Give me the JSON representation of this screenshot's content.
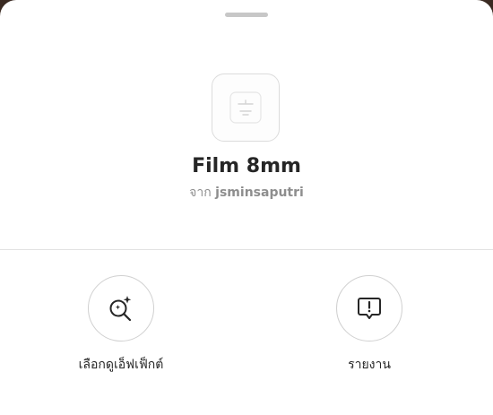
{
  "sheet": {
    "effect": {
      "title": "Film 8mm",
      "author_prefix": "จาก",
      "author_name": "jsminsaputri",
      "thumbnail_icon": "film-effect-icon"
    },
    "actions": [
      {
        "label": "เลือกดูเอ็ฟเฟ็กต์",
        "icon": "browse-effects-icon"
      },
      {
        "label": "รายงาน",
        "icon": "report-icon"
      }
    ]
  },
  "colors": {
    "sheet_bg": "#ffffff",
    "text_primary": "#262626",
    "text_secondary": "#8e8e8e",
    "border": "#d0d0d0"
  }
}
